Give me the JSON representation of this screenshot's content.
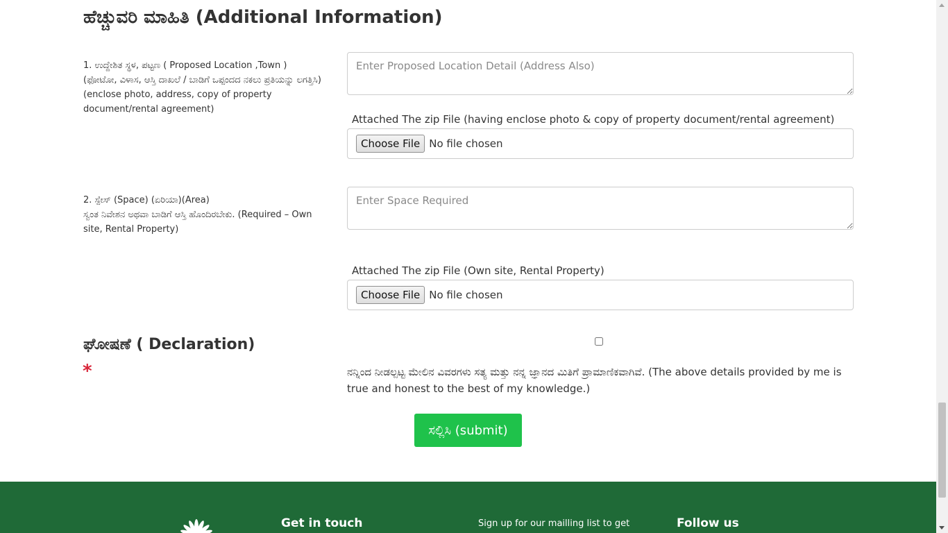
{
  "section": {
    "title": "ಹೆಚ್ಚುವರಿ ಮಾಹಿತಿ (Additional Information)"
  },
  "location": {
    "label_line1": "1. ಉದ್ದೇಶಿತ ಸ್ಥಳ, ಪಟ್ಟಣ ( Proposed Location ,Town )",
    "label_line2": "(ಫೋಟೋ, ವಿಳಾಸ, ಆಸ್ತಿ ದಾಖಲೆ / ಬಾಡಿಗೆ ಒಪ್ಪಂದದ ನಕಲು ಪ್ರತಿಯನ್ನು ಲಗತ್ತಿಸಿ)(enclose photo, address, copy of property document/rental agreement)",
    "placeholder": "Enter Proposed Location Detail (Address Also)",
    "value": "",
    "attach_label": "Attached The zip File (having enclose photo & copy of property document/rental agreement)",
    "choose_label": "Choose File",
    "file_status": "No file chosen"
  },
  "space": {
    "label_line1": "2. ಸ್ಪೇಸ್ (Space) (ಏರಿಯಾ)(Area)",
    "label_line2": "ಸ್ವಂತ ನಿವೇಶನ ಅಥವಾ ಬಾಡಿಗೆ ಆಸ್ತಿ ಹೊಂದಿರಬೇಕು. (Required – Own site, Rental Property)",
    "placeholder": "Enter Space Required",
    "value": "",
    "attach_label": "Attached The zip File (Own site, Rental Property)",
    "choose_label": "Choose File",
    "file_status": "No file chosen"
  },
  "declaration": {
    "title": "ಘೋಷಣೆ ( Declaration)",
    "required_mark": "*",
    "checked": false,
    "text": "ನನ್ನಿಂದ ನೀಡಲ್ಪಟ್ಟ ಮೇಲಿನ ವಿವರಗಳು ಸತ್ಯ ಮತ್ತು ನನ್ನ ಜ್ಞಾನದ ಮಿತಿಗೆ ಪ್ರಾಮಾಣಿಕವಾಗಿವೆ. (The above details provided by me is true and honest to the best of my knowledge.)"
  },
  "submit": {
    "label": "ಸಲ್ಲಿಸಿ (submit)"
  },
  "footer": {
    "get_in_touch": "Get in touch",
    "mailing": "Sign up for our mailling list to get",
    "follow_us": "Follow us"
  },
  "colors": {
    "submit_bg": "#1fc24b",
    "footer_bg": "#1f6a37",
    "required_star": "#d9263a"
  }
}
